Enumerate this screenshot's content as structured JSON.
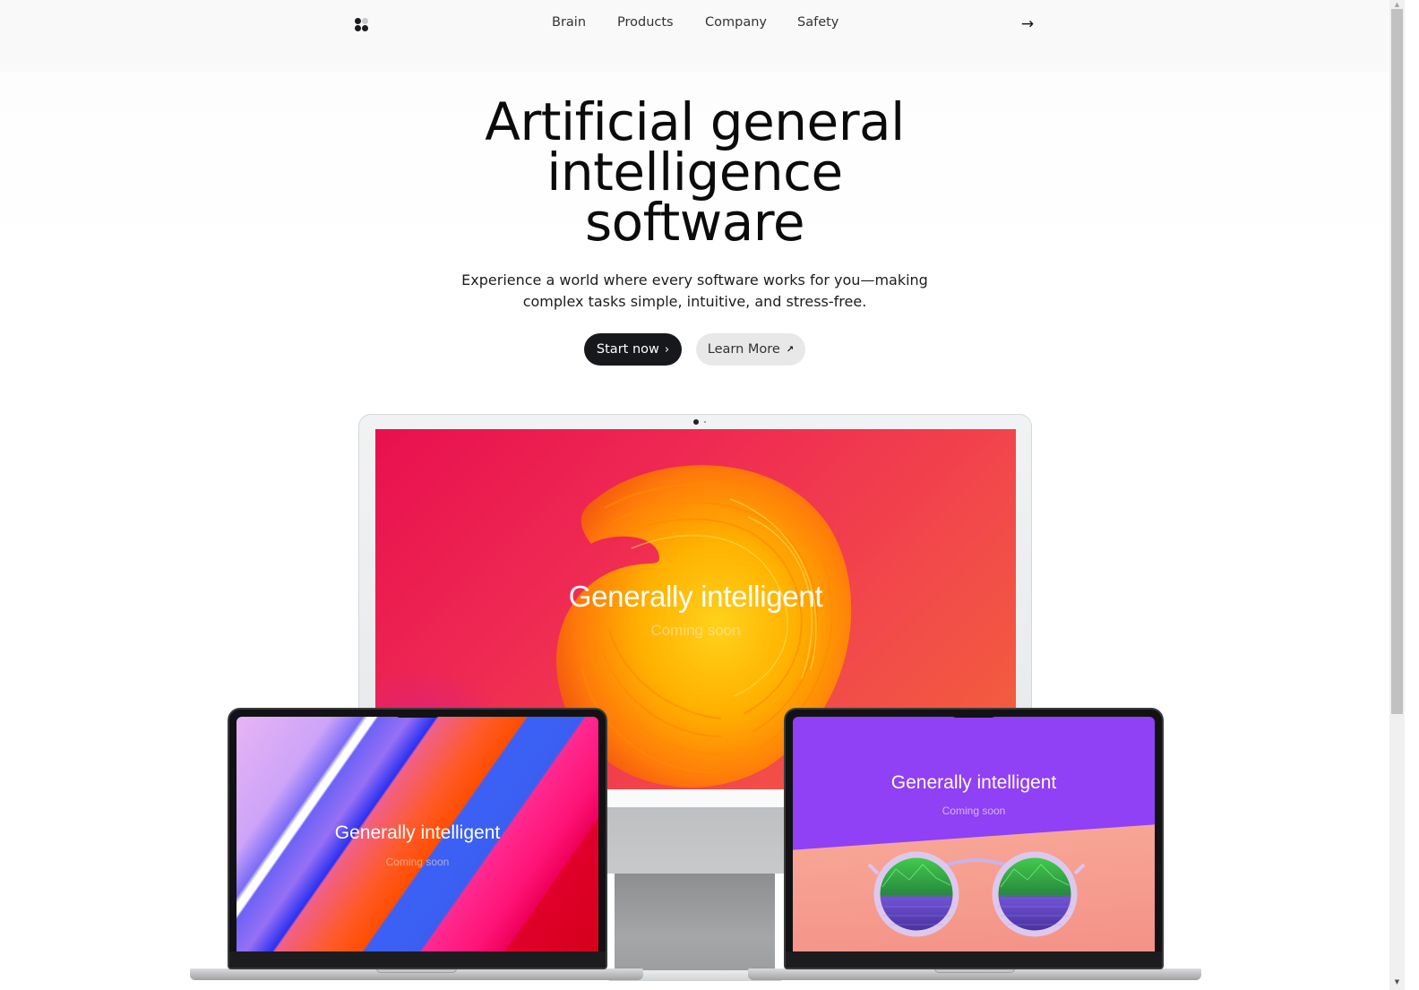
{
  "nav": {
    "logo_icon": "four-dots-logo",
    "links": [
      {
        "label": "Brain"
      },
      {
        "label": "Products"
      },
      {
        "label": "Company"
      },
      {
        "label": "Safety"
      }
    ],
    "cta_icon": "→"
  },
  "hero": {
    "title_lines": [
      "Artificial general",
      "intelligence",
      "software"
    ],
    "subtitle_lines": [
      "Experience a world where every software works for you—making",
      "complex tasks simple, intuitive, and stress-free."
    ],
    "primary_button": {
      "label": "Start now",
      "icon": "›"
    },
    "secondary_button": {
      "label": "Learn More",
      "icon": "↗"
    }
  },
  "devices": {
    "imac": {
      "title": "Generally intelligent",
      "subtitle": "Coming soon"
    },
    "laptop_left": {
      "title": "Generally intelligent",
      "subtitle": "Coming soon"
    },
    "laptop_right": {
      "title": "Generally intelligent",
      "subtitle": "Coming soon"
    }
  },
  "colors": {
    "primary_button_bg": "#17181b",
    "secondary_button_bg": "#e8e8e9",
    "imac_screen_start": "#e8104f",
    "imac_screen_end": "#f3623a",
    "laptop_right_bg": "#9040f5"
  },
  "scrollbar": {
    "up_icon": "▲",
    "down_icon": "▼"
  }
}
